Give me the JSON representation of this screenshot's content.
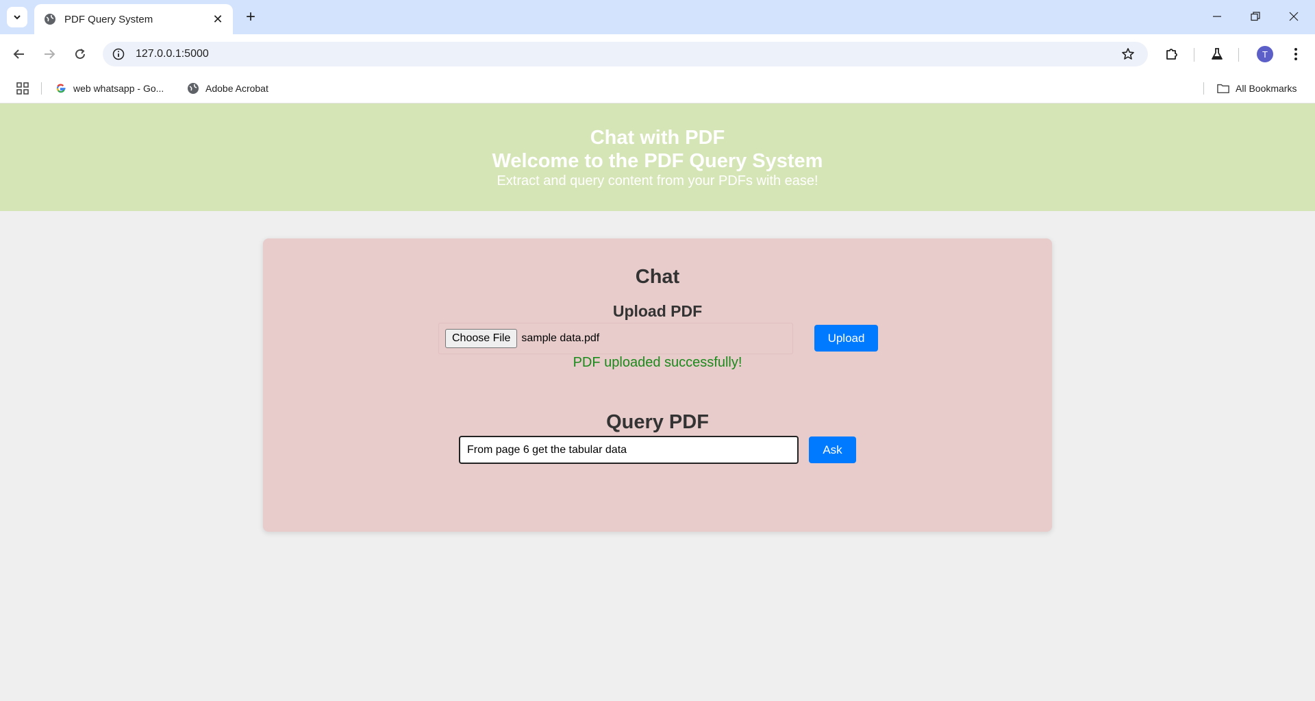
{
  "browser": {
    "tab": {
      "title": "PDF Query System",
      "close": "✕"
    },
    "new_tab": "+",
    "address": {
      "url": "127.0.0.1:5000"
    },
    "profile_initial": "T",
    "bookmarks": [
      {
        "label": "web whatsapp - Go..."
      },
      {
        "label": "Adobe Acrobat"
      }
    ],
    "all_bookmarks": "All Bookmarks"
  },
  "header": {
    "title": "Chat with PDF",
    "welcome": "Welcome to the PDF Query System",
    "subtitle": "Extract and query content from your PDFs with ease!"
  },
  "chat": {
    "title": "Chat",
    "upload": {
      "heading": "Upload PDF",
      "choose_label": "Choose File",
      "file_name": "sample data.pdf",
      "button": "Upload",
      "status": "PDF uploaded successfully!"
    },
    "query": {
      "heading": "Query PDF",
      "value": "From page 6 get the tabular data",
      "button": "Ask"
    }
  },
  "colors": {
    "header_bg": "#d5e5b5",
    "card_bg": "#e8cbcb",
    "button_blue": "#007bff",
    "success_green": "#1a8a1a"
  }
}
